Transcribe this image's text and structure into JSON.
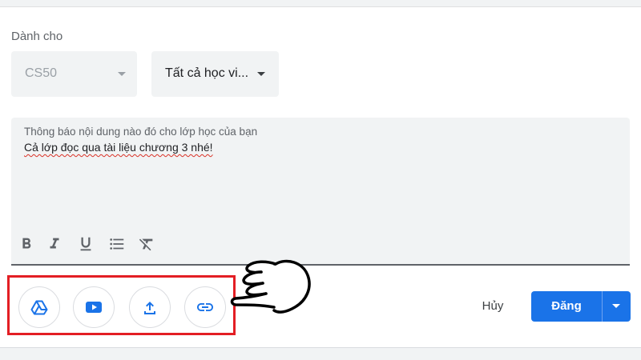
{
  "audience": {
    "label": "Dành cho",
    "class_value": "CS50",
    "students_value": "Tất cả học vi..."
  },
  "editor": {
    "placeholder": "Thông báo nội dung nào đó cho lớp học của bạn",
    "text": "Cả lớp đọc qua tài liệu chương 3 nhé!"
  },
  "toolbar": {
    "icons": [
      "bold-icon",
      "italic-icon",
      "underline-icon",
      "bulleted-list-icon",
      "clear-formatting-icon"
    ]
  },
  "attachments": {
    "icons": [
      "google-drive-icon",
      "youtube-icon",
      "upload-icon",
      "link-icon"
    ]
  },
  "actions": {
    "cancel_label": "Hủy",
    "post_label": "Đăng"
  },
  "colors": {
    "primary": "#1a73e8",
    "highlight": "#e31e24",
    "field_bg": "#f1f3f4"
  }
}
